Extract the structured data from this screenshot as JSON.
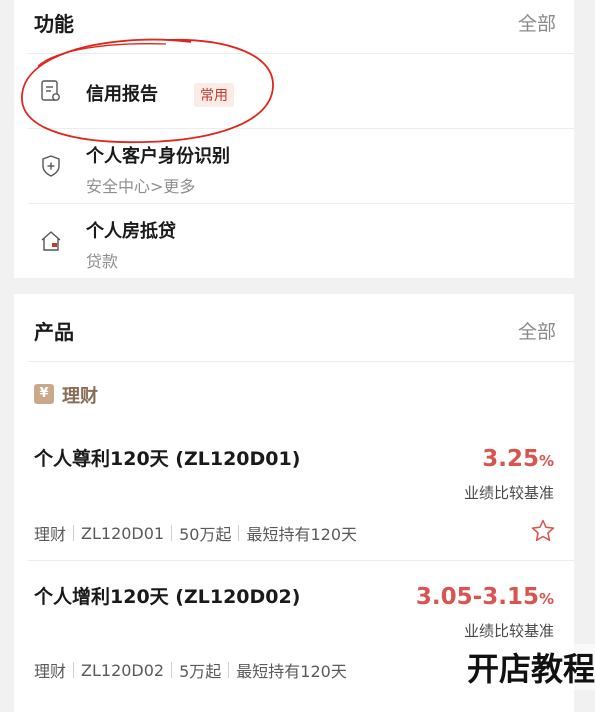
{
  "functions": {
    "title": "功能",
    "more_label": "全部",
    "items": [
      {
        "title": "信用报告",
        "badge": "常用",
        "icon": "credit-report-icon"
      },
      {
        "title": "个人客户身份识别",
        "subtitle": "安全中心>更多",
        "icon": "shield-plus-icon"
      },
      {
        "title": "个人房抵贷",
        "subtitle": "贷款",
        "icon": "house-icon"
      }
    ]
  },
  "products": {
    "title": "产品",
    "more_label": "全部",
    "category": {
      "icon_glyph": "¥",
      "label": "理财"
    },
    "items": [
      {
        "name": "个人尊利120天 (ZL120D01)",
        "rate": "3.25",
        "rate_unit": "%",
        "rate_label": "业绩比较基准",
        "tags": [
          "理财",
          "ZL120D01",
          "50万起",
          "最短持有120天"
        ]
      },
      {
        "name": "个人增利120天 (ZL120D02)",
        "rate": "3.05-3.15",
        "rate_unit": "%",
        "rate_label": "业绩比较基准",
        "tags": [
          "理财",
          "ZL120D02",
          "5万起",
          "最短持有120天"
        ]
      }
    ]
  },
  "watermark": "开店教程",
  "colors": {
    "accent_red": "#d9534f",
    "badge_red": "#c23a2b",
    "annotation_red": "#e0251b",
    "category_brown": "#8a6d55"
  }
}
